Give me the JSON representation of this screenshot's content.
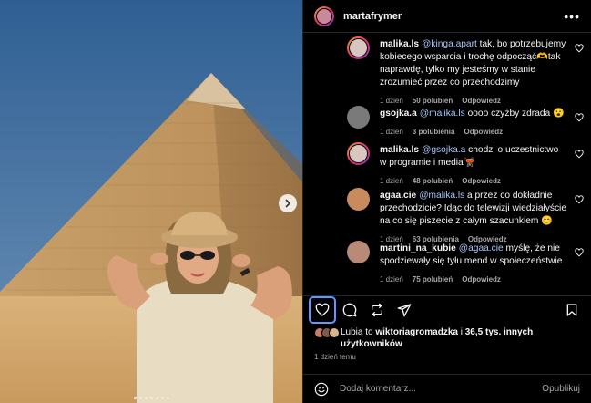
{
  "post": {
    "author": "martafrymer"
  },
  "comments": [
    {
      "user": "malika.ls",
      "mention": "@kinga.apart",
      "text": " tak, bo potrzebujemy kobiecego wsparcia i trochę odpocząć🫶tak naprawdę, tylko my jesteśmy w stanie zrozumieć przez co przechodzimy",
      "time": "1 dzień",
      "likes": "50 polubień",
      "reply": "Odpowiedz",
      "avatar_color": "#d8c6c0",
      "ring": true
    },
    {
      "user": "gsojka.a",
      "mention": "@malika.ls",
      "text": " oooo czyżby zdrada 😮",
      "time": "1 dzień",
      "likes": "3 polubienia",
      "reply": "Odpowiedz",
      "avatar_color": "#7a7a7a",
      "ring": false
    },
    {
      "user": "malika.ls",
      "mention": "@gsojka.a",
      "text": " chodzi o uczestnictwo w programie i media🫕",
      "time": "1 dzień",
      "likes": "48 polubień",
      "reply": "Odpowiedz",
      "avatar_color": "#d8c6c0",
      "ring": true
    },
    {
      "user": "agaa.cie",
      "mention": "@malika.ls",
      "text": " a przez co dokładnie przechodzicie? Idąc do telewizji wiedziałyście na co się piszecie z całym szacunkiem 😊",
      "time": "1 dzień",
      "likes": "63 polubienia",
      "reply": "Odpowiedz",
      "avatar_color": "#c98b5e",
      "ring": false
    },
    {
      "user": "martini_na_kubie",
      "mention": "@agaa.cie",
      "text": " myślę, że nie spodziewały się tyłu mend w społeczeństwie",
      "time": "1 dzień",
      "likes": "75 polubień",
      "reply": "Odpowiedz",
      "avatar_color": "#b98a78",
      "ring": false
    }
  ],
  "likes": {
    "prefix": "Lubią to ",
    "user": "wiktoriagromadzka",
    "middle": " i ",
    "others": "36,5 tys. innych użytkowników"
  },
  "time_ago": "1 dzień temu",
  "add_comment": {
    "placeholder": "Dodaj komentarz...",
    "publish": "Opublikuj"
  },
  "carousel": {
    "total": 7,
    "active_index": 0
  },
  "colors": {
    "background": "#000000",
    "text": "#f5f5f5",
    "muted": "#a8a8a8",
    "mention": "#a8c7fa",
    "focus": "#5b9bff"
  }
}
